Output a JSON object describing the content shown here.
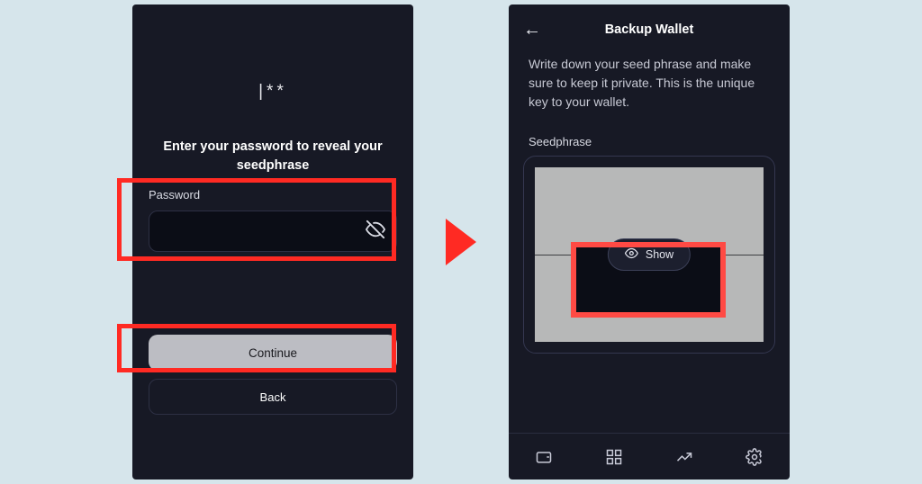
{
  "left": {
    "asterisks": "|**",
    "instruction": "Enter your password to reveal your seedphrase",
    "password_label": "Password",
    "continue_label": "Continue",
    "back_label": "Back"
  },
  "right": {
    "title": "Backup Wallet",
    "description": "Write down your seed phrase and make sure to keep it private. This is the unique key to your wallet.",
    "seed_label": "Seedphrase",
    "show_label": "Show"
  }
}
